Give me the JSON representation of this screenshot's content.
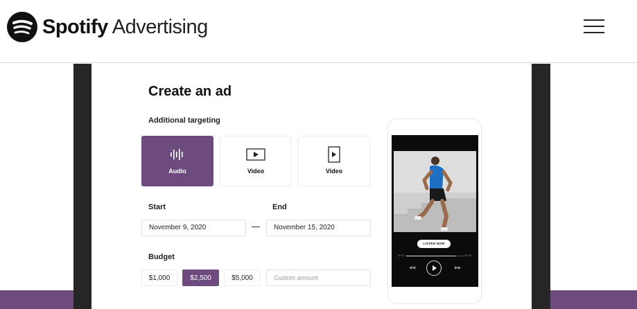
{
  "header": {
    "brand_name": "Spotify",
    "brand_suffix": "Advertising",
    "menu_icon": "hamburger-menu-icon"
  },
  "form": {
    "title": "Create an ad",
    "targeting_label": "Additional targeting",
    "targeting_options": [
      {
        "label": "Audio",
        "icon": "audio-waveform-icon",
        "selected": true
      },
      {
        "label": "Video",
        "icon": "video-landscape-icon",
        "selected": false
      },
      {
        "label": "Video",
        "icon": "video-portrait-icon",
        "selected": false
      }
    ],
    "start_label": "Start",
    "start_value": "November 9, 2020",
    "end_label": "End",
    "end_value": "November 15, 2020",
    "budget_label": "Budget",
    "budget_options": [
      {
        "label": "$1,000",
        "selected": false
      },
      {
        "label": "$2,500",
        "selected": true
      },
      {
        "label": "$5,000",
        "selected": false
      }
    ],
    "custom_amount_placeholder": "Custom amount"
  },
  "phone_preview": {
    "cta_label": "LISTEN NOW",
    "elapsed": "00:12",
    "remaining": "00:30",
    "progress": 0.85,
    "prev_icon": "skip-back-icon",
    "play_icon": "play-icon",
    "next_icon": "skip-forward-icon"
  },
  "colors": {
    "accent": "#6e4b7e",
    "frame": "#262626",
    "brand_text": "#111111"
  }
}
